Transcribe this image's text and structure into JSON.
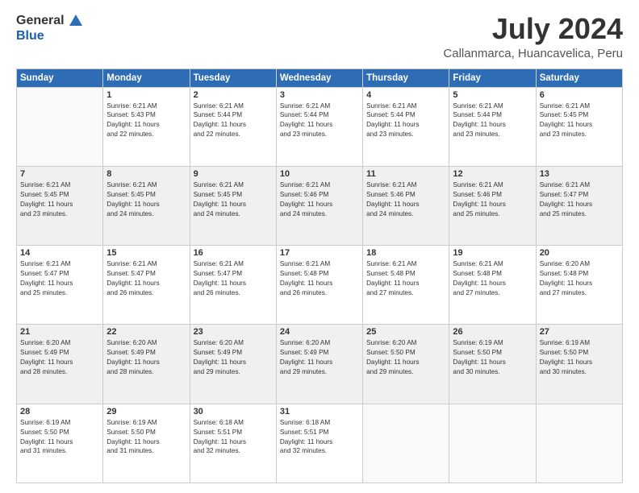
{
  "header": {
    "logo_general": "General",
    "logo_blue": "Blue",
    "title": "July 2024",
    "subtitle": "Callanmarca, Huancavelica, Peru"
  },
  "weekdays": [
    "Sunday",
    "Monday",
    "Tuesday",
    "Wednesday",
    "Thursday",
    "Friday",
    "Saturday"
  ],
  "weeks": [
    [
      {
        "day": "",
        "info": ""
      },
      {
        "day": "1",
        "info": "Sunrise: 6:21 AM\nSunset: 5:43 PM\nDaylight: 11 hours\nand 22 minutes."
      },
      {
        "day": "2",
        "info": "Sunrise: 6:21 AM\nSunset: 5:44 PM\nDaylight: 11 hours\nand 22 minutes."
      },
      {
        "day": "3",
        "info": "Sunrise: 6:21 AM\nSunset: 5:44 PM\nDaylight: 11 hours\nand 23 minutes."
      },
      {
        "day": "4",
        "info": "Sunrise: 6:21 AM\nSunset: 5:44 PM\nDaylight: 11 hours\nand 23 minutes."
      },
      {
        "day": "5",
        "info": "Sunrise: 6:21 AM\nSunset: 5:44 PM\nDaylight: 11 hours\nand 23 minutes."
      },
      {
        "day": "6",
        "info": "Sunrise: 6:21 AM\nSunset: 5:45 PM\nDaylight: 11 hours\nand 23 minutes."
      }
    ],
    [
      {
        "day": "7",
        "info": "Sunrise: 6:21 AM\nSunset: 5:45 PM\nDaylight: 11 hours\nand 23 minutes."
      },
      {
        "day": "8",
        "info": "Sunrise: 6:21 AM\nSunset: 5:45 PM\nDaylight: 11 hours\nand 24 minutes."
      },
      {
        "day": "9",
        "info": "Sunrise: 6:21 AM\nSunset: 5:45 PM\nDaylight: 11 hours\nand 24 minutes."
      },
      {
        "day": "10",
        "info": "Sunrise: 6:21 AM\nSunset: 5:46 PM\nDaylight: 11 hours\nand 24 minutes."
      },
      {
        "day": "11",
        "info": "Sunrise: 6:21 AM\nSunset: 5:46 PM\nDaylight: 11 hours\nand 24 minutes."
      },
      {
        "day": "12",
        "info": "Sunrise: 6:21 AM\nSunset: 5:46 PM\nDaylight: 11 hours\nand 25 minutes."
      },
      {
        "day": "13",
        "info": "Sunrise: 6:21 AM\nSunset: 5:47 PM\nDaylight: 11 hours\nand 25 minutes."
      }
    ],
    [
      {
        "day": "14",
        "info": "Sunrise: 6:21 AM\nSunset: 5:47 PM\nDaylight: 11 hours\nand 25 minutes."
      },
      {
        "day": "15",
        "info": "Sunrise: 6:21 AM\nSunset: 5:47 PM\nDaylight: 11 hours\nand 26 minutes."
      },
      {
        "day": "16",
        "info": "Sunrise: 6:21 AM\nSunset: 5:47 PM\nDaylight: 11 hours\nand 26 minutes."
      },
      {
        "day": "17",
        "info": "Sunrise: 6:21 AM\nSunset: 5:48 PM\nDaylight: 11 hours\nand 26 minutes."
      },
      {
        "day": "18",
        "info": "Sunrise: 6:21 AM\nSunset: 5:48 PM\nDaylight: 11 hours\nand 27 minutes."
      },
      {
        "day": "19",
        "info": "Sunrise: 6:21 AM\nSunset: 5:48 PM\nDaylight: 11 hours\nand 27 minutes."
      },
      {
        "day": "20",
        "info": "Sunrise: 6:20 AM\nSunset: 5:48 PM\nDaylight: 11 hours\nand 27 minutes."
      }
    ],
    [
      {
        "day": "21",
        "info": "Sunrise: 6:20 AM\nSunset: 5:49 PM\nDaylight: 11 hours\nand 28 minutes."
      },
      {
        "day": "22",
        "info": "Sunrise: 6:20 AM\nSunset: 5:49 PM\nDaylight: 11 hours\nand 28 minutes."
      },
      {
        "day": "23",
        "info": "Sunrise: 6:20 AM\nSunset: 5:49 PM\nDaylight: 11 hours\nand 29 minutes."
      },
      {
        "day": "24",
        "info": "Sunrise: 6:20 AM\nSunset: 5:49 PM\nDaylight: 11 hours\nand 29 minutes."
      },
      {
        "day": "25",
        "info": "Sunrise: 6:20 AM\nSunset: 5:50 PM\nDaylight: 11 hours\nand 29 minutes."
      },
      {
        "day": "26",
        "info": "Sunrise: 6:19 AM\nSunset: 5:50 PM\nDaylight: 11 hours\nand 30 minutes."
      },
      {
        "day": "27",
        "info": "Sunrise: 6:19 AM\nSunset: 5:50 PM\nDaylight: 11 hours\nand 30 minutes."
      }
    ],
    [
      {
        "day": "28",
        "info": "Sunrise: 6:19 AM\nSunset: 5:50 PM\nDaylight: 11 hours\nand 31 minutes."
      },
      {
        "day": "29",
        "info": "Sunrise: 6:19 AM\nSunset: 5:50 PM\nDaylight: 11 hours\nand 31 minutes."
      },
      {
        "day": "30",
        "info": "Sunrise: 6:18 AM\nSunset: 5:51 PM\nDaylight: 11 hours\nand 32 minutes."
      },
      {
        "day": "31",
        "info": "Sunrise: 6:18 AM\nSunset: 5:51 PM\nDaylight: 11 hours\nand 32 minutes."
      },
      {
        "day": "",
        "info": ""
      },
      {
        "day": "",
        "info": ""
      },
      {
        "day": "",
        "info": ""
      }
    ]
  ]
}
